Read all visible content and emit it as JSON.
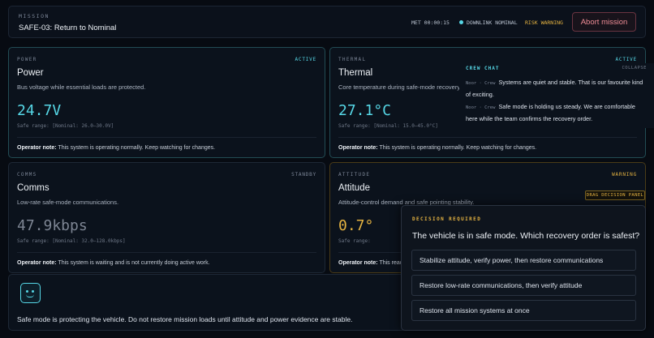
{
  "header": {
    "eyebrow": "MISSION",
    "title": "SAFE-03: Return to Nominal",
    "met": "MET 00:00:15",
    "downlink": "DOWNLINK NOMINAL",
    "risk": "RISK WARNING",
    "abort_label": "Abort mission"
  },
  "panels": {
    "power": {
      "label": "POWER",
      "status": "ACTIVE",
      "title": "Power",
      "desc": "Bus voltage while essential loads are protected.",
      "value": "24.7V",
      "range": "Safe range: [Nominal: 26.0–30.0V]",
      "note_label": "Operator note:",
      "note": " This system is operating normally. Keep watching for changes."
    },
    "thermal": {
      "label": "THERMAL",
      "status": "ACTIVE",
      "title": "Thermal",
      "desc": "Core temperature during safe-mode recovery.",
      "value": "27.1°C",
      "range": "Safe range: [Nominal: 15.0–45.0°C]",
      "note_label": "Operator note:",
      "note": " This system is operating normally. Keep watching for changes."
    },
    "comms": {
      "label": "COMMS",
      "status": "STANDBY",
      "title": "Comms",
      "desc": "Low-rate safe-mode communications.",
      "value": "47.9kbps",
      "range": "Safe range: [Nominal: 32.0–128.0kbps]",
      "note_label": "Operator note:",
      "note": " This system is waiting and is not currently doing active work."
    },
    "attitude": {
      "label": "ATTITUDE",
      "status": "WARNING",
      "title": "Attitude",
      "desc": "Attitude-control demand and safe pointing stability.",
      "value": "0.7°",
      "range": "Safe range:",
      "note_label": "Operator note:",
      "note": " This readi"
    }
  },
  "chat": {
    "title": "CREW CHAT",
    "collapse": "COLLAPSE",
    "messages": [
      {
        "who": "Noor · Crew",
        "text": "Systems are quiet and stable. That is our favourite kind of exciting."
      },
      {
        "who": "Noor · Crew",
        "text": "Safe mode is holding us steady. We are comfortable here while the team confirms the recovery order."
      }
    ]
  },
  "banner": {
    "text": "Safe mode is protecting the vehicle. Do not restore mission loads until attitude and power evidence are stable."
  },
  "drag_badge": "DRAG DECISION PANEL",
  "decision": {
    "eyebrow": "DECISION REQUIRED",
    "question": "The vehicle is in safe mode. Which recovery order is safest?",
    "options": [
      "Stabilize attitude, verify power, then restore communications",
      "Restore low-rate communications, then verify attitude",
      "Restore all mission systems at once"
    ]
  },
  "colors": {
    "accent": "#56d7e6",
    "warning": "#e5b341",
    "danger": "#f08d96",
    "background": "#070b12"
  }
}
